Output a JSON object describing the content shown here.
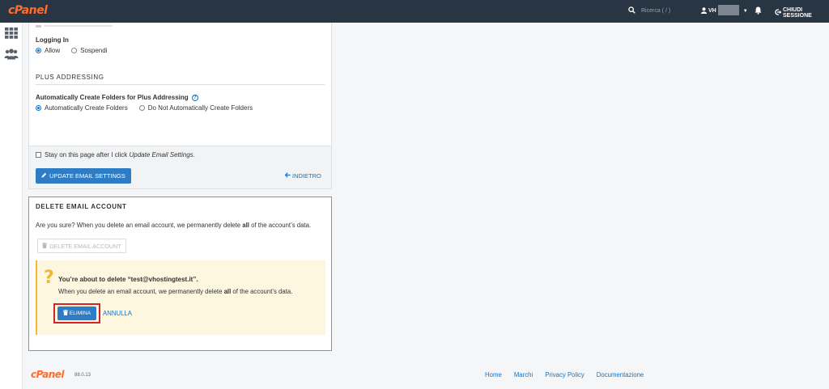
{
  "header": {
    "logo": "cPanel",
    "search_placeholder": "Ricerca ( / )",
    "user_name": "VH",
    "logout_label": "CHIUDI SESSIONE",
    "icons": [
      "search-icon",
      "user-icon",
      "bell-icon",
      "logout-icon"
    ]
  },
  "sidebar": {
    "items": [
      {
        "icon": "grid-icon"
      },
      {
        "icon": "users-icon"
      }
    ]
  },
  "form": {
    "logging_in": {
      "label": "Logging In",
      "options": [
        {
          "label": "Allow",
          "selected": true
        },
        {
          "label": "Sospendi",
          "selected": false
        }
      ]
    },
    "plus_addressing": {
      "heading": "PLUS ADDRESSING",
      "label": "Automatically Create Folders for Plus Addressing",
      "help_icon": "question-icon",
      "options": [
        {
          "label": "Automatically Create Folders",
          "selected": true
        },
        {
          "label": "Do Not Automatically Create Folders",
          "selected": false
        }
      ]
    },
    "stay_checkbox": {
      "label_prefix": "Stay on this page after I click ",
      "label_emphasis": "Update Email Settings",
      "label_suffix": ".",
      "checked": false
    },
    "update_button": "UPDATE EMAIL SETTINGS",
    "back_link": "INDIETRO"
  },
  "delete_section": {
    "title": "DELETE EMAIL ACCOUNT",
    "warning_prefix": "Are you sure? When you delete an email account, we permanently delete ",
    "warning_bold": "all",
    "warning_suffix": " of the account’s data.",
    "delete_button": "DELETE EMAIL ACCOUNT",
    "confirm": {
      "title": "You’re about to delete “test@vhostingtest.it”.",
      "text_prefix": "When you delete an email account, we permanently delete ",
      "text_bold": "all",
      "text_suffix": " of the account’s data.",
      "delete_label": "ELIMINA",
      "cancel_label": "ANNULLA"
    }
  },
  "footer": {
    "logo": "cPanel",
    "version": "88.0.13",
    "links": [
      "Home",
      "Marchi",
      "Privacy Policy",
      "Documentazione"
    ]
  },
  "colors": {
    "topbar": "#283543",
    "brand": "#ff6c2c",
    "primary": "#2d7cc4",
    "link": "#1473c6",
    "danger_border": "#e87350",
    "highlight_frame": "#d4232a",
    "alert_bg": "#fdf7e0"
  }
}
